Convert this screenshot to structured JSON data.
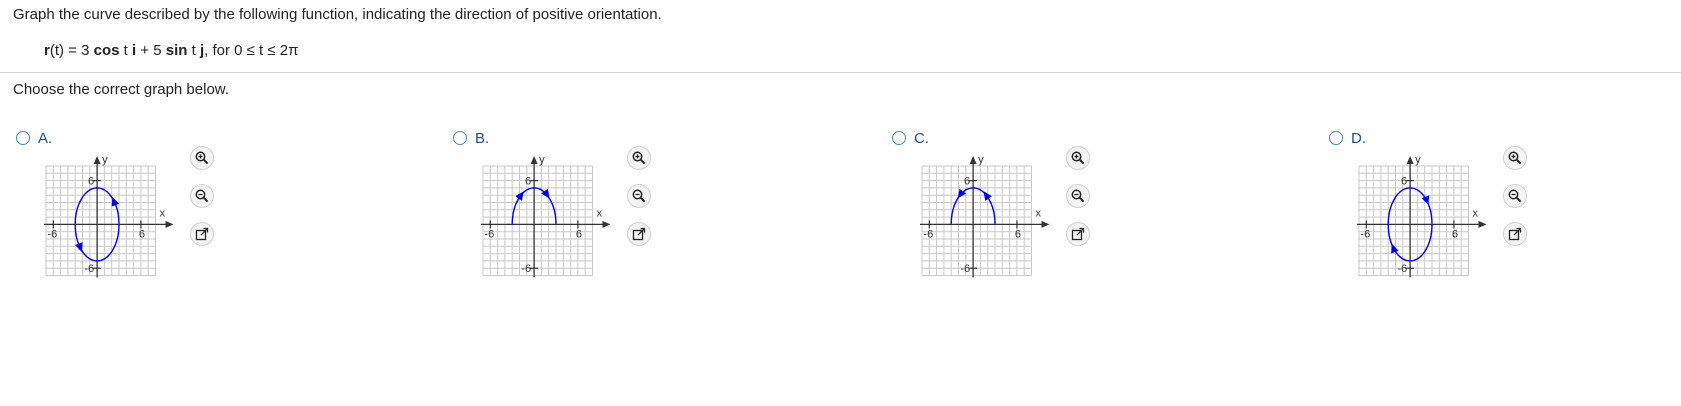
{
  "question": {
    "prompt": "Graph the curve described by the following function, indicating the direction of positive orientation.",
    "formula_parts": [
      "r",
      "(t) = 3 ",
      "cos",
      " t ",
      "i",
      " + 5 ",
      "sin",
      " t ",
      "j",
      ", for 0 ≤ t ≤ 2π"
    ]
  },
  "instruction": "Choose the correct graph below.",
  "options": [
    {
      "letter": "A.",
      "curve": "full-ellipse",
      "arrows": "counterclockwise"
    },
    {
      "letter": "B.",
      "curve": "upper-half",
      "arrows": "left-to-right"
    },
    {
      "letter": "C.",
      "curve": "upper-half",
      "arrows": "right-to-left"
    },
    {
      "letter": "D.",
      "curve": "full-ellipse",
      "arrows": "clockwise"
    }
  ],
  "graph_labels": {
    "y": "y",
    "x": "x",
    "ymax": "6",
    "ymin": "-6",
    "xmin": "-6",
    "xmax": "6"
  },
  "colors": {
    "curve": "#0000ee",
    "grid": "#c8c8c8",
    "axis": "#333333",
    "radio": "#4a86c8",
    "letter": "#1a4d96"
  },
  "tool_icons": [
    "zoom-in-icon",
    "zoom-out-icon",
    "expand-icon"
  ]
}
